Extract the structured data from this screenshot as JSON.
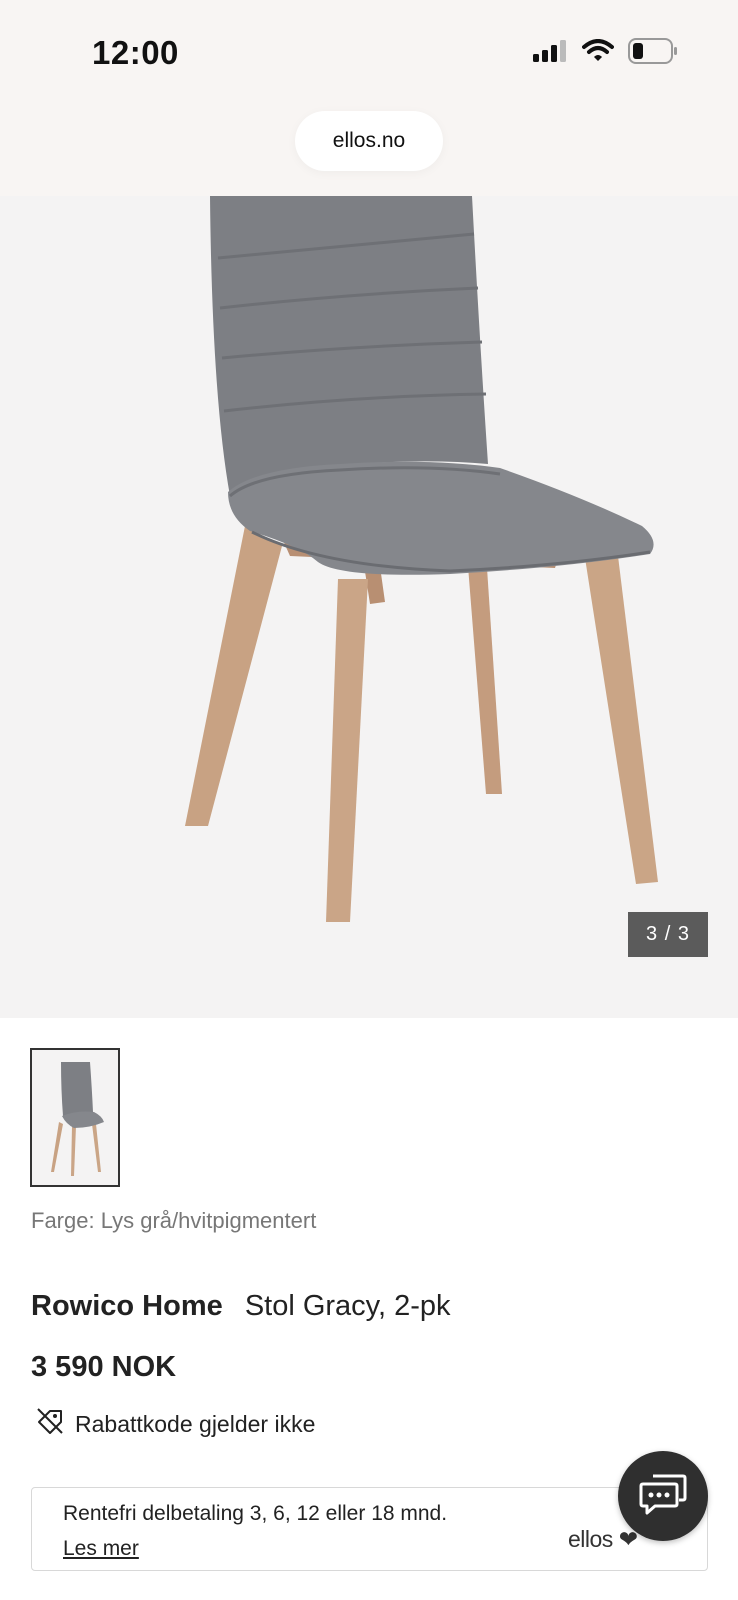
{
  "status_bar": {
    "time": "12:00"
  },
  "browser": {
    "url": "ellos.no"
  },
  "gallery": {
    "counter": "3 / 3"
  },
  "product": {
    "color_line": "Farge: Lys grå/hvitpigmentert",
    "brand": "Rowico Home",
    "name": "Stol Gracy, 2-pk",
    "price": "3 590 NOK",
    "promo_note": "Rabattkode gjelder ikke"
  },
  "financing": {
    "text": "Rentefri delbetaling 3, 6, 12 eller 18 mnd.",
    "link": "Les mer",
    "logo": "ellos"
  },
  "icons": {
    "signal": "cellular-signal-icon",
    "wifi": "wifi-icon",
    "battery": "battery-icon",
    "tag": "tag-off-icon",
    "chat": "chat-bubble-icon"
  },
  "colors": {
    "counter_bg": "#5b5b5b",
    "chat_bg": "#2f2f2f",
    "top_bg": "#f8f5f3",
    "hero_bg": "#f4f3f3"
  }
}
